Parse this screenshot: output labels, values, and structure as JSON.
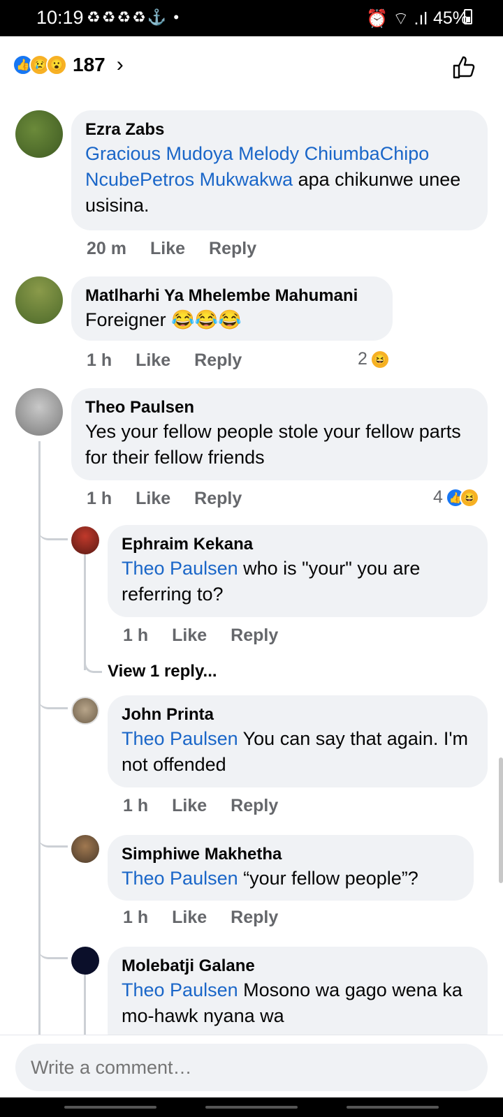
{
  "status_bar": {
    "time": "10:19",
    "left_icons": "♻♻♻♻⚓ •",
    "right_icons": "⏰ ⌔ .ıl",
    "battery": "45%"
  },
  "reactions": {
    "count": "187",
    "icons": [
      "like-icon",
      "sad-icon",
      "wow-icon"
    ]
  },
  "comments": [
    {
      "name": "Ezra Zabs",
      "mention": "Gracious Mudoya Melody ChiumbaChipo NcubePetros Mukwakwa",
      "text": " apa chikunwe unee usisina.",
      "time": "20 m",
      "like": "Like",
      "reply": "Reply"
    },
    {
      "name": "Matlharhi Ya Mhelembe Mahumani",
      "text": "Foreigner 😂😂😂",
      "time": "1 h",
      "like": "Like",
      "reply": "Reply",
      "reaction_count": "2"
    },
    {
      "name": "Theo Paulsen",
      "text": "Yes your fellow people stole your fellow parts for their fellow friends",
      "time": "1 h",
      "like": "Like",
      "reply": "Reply",
      "reaction_count": "4"
    }
  ],
  "replies": [
    {
      "name": "Ephraim Kekana",
      "mention": "Theo Paulsen",
      "text": " who is \"your\" you are referring to?",
      "time": "1 h",
      "like": "Like",
      "reply": "Reply"
    },
    {
      "name": "John Printa",
      "mention": "Theo Paulsen",
      "text": " You can say that again.  I'm not offended",
      "time": "1 h",
      "like": "Like",
      "reply": "Reply"
    },
    {
      "name": "Simphiwe Makhetha",
      "mention": "Theo Paulsen",
      "text": " “your fellow people”?",
      "time": "1 h",
      "like": "Like",
      "reply": "Reply"
    },
    {
      "name": "Molebatji Galane",
      "mention": "Theo Paulsen",
      "text": " Mosono wa gago wena ka mo-hawk nyana wa",
      "time": "",
      "like": "",
      "reply": ""
    }
  ],
  "view_more": "View 1 reply...",
  "composer": {
    "placeholder": "Write a comment…"
  },
  "colors": {
    "mention": "#1a66c8",
    "bubble": "#f0f2f5",
    "like_blue": "#1877f2",
    "emoji_yellow": "#f7b125"
  }
}
